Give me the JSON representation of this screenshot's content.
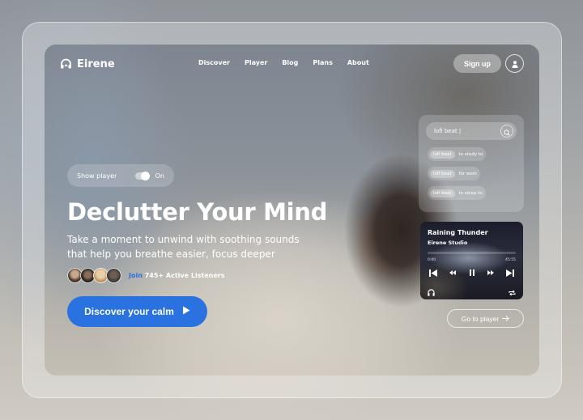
{
  "brand": {
    "name": "Eirene",
    "logo_icon": "headphones-icon"
  },
  "nav": {
    "links": [
      {
        "label": "Discover"
      },
      {
        "label": "Player"
      },
      {
        "label": "Blog"
      },
      {
        "label": "Plans"
      },
      {
        "label": "About"
      }
    ],
    "signup_label": "Sign up",
    "user_icon": "user-icon"
  },
  "toggle": {
    "label": "Show player",
    "state_label": "On",
    "on": true
  },
  "hero": {
    "headline": "Declutter Your Mind",
    "subtitle_line1": "Take a moment to unwind with soothing sounds",
    "subtitle_line2": "that help you breathe easier, focus deeper",
    "join_label": "Join",
    "listeners_label": "745+ Active Listeners",
    "cta_label": "Discover your calm",
    "avatar_count": 4
  },
  "search": {
    "value": "lofi beat |",
    "suggestions": [
      {
        "chip": "lofi beat",
        "text": "to study to"
      },
      {
        "chip": "lofi beat",
        "text": "for work"
      },
      {
        "chip": "lofi beat",
        "text": "to sleep to"
      }
    ]
  },
  "player": {
    "title": "Raining Thunder",
    "artist": "Eirene Studio",
    "time_current": "0:00",
    "time_total": "45:55",
    "progress": 0
  },
  "go_player_label": "Go to player",
  "colors": {
    "accent": "#2a72e0"
  }
}
